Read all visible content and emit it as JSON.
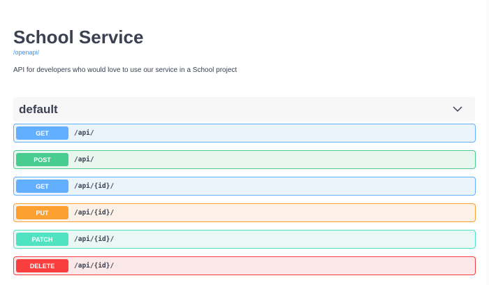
{
  "info": {
    "title": "School Service",
    "spec_link": "/openapi/",
    "description": "API for developers who would love to use our service in a School project"
  },
  "tag": {
    "name": "default"
  },
  "operations": [
    {
      "method": "GET",
      "path": "/api/",
      "color": "#61affe",
      "bg": "#ebf3fb",
      "border": "#61affe"
    },
    {
      "method": "POST",
      "path": "/api/",
      "color": "#49cc90",
      "bg": "#e8f6f0",
      "border": "#49cc90"
    },
    {
      "method": "GET",
      "path": "/api/{id}/",
      "color": "#61affe",
      "bg": "#ebf3fb",
      "border": "#61affe"
    },
    {
      "method": "PUT",
      "path": "/api/{id}/",
      "color": "#fca130",
      "bg": "#fbf1e6",
      "border": "#fca130"
    },
    {
      "method": "PATCH",
      "path": "/api/{id}/",
      "color": "#50e3c2",
      "bg": "#e9f8f4",
      "border": "#50e3c2"
    },
    {
      "method": "DELETE",
      "path": "/api/{id}/",
      "color": "#f93e3e",
      "bg": "#fae7e7",
      "border": "#f93e3e"
    }
  ]
}
